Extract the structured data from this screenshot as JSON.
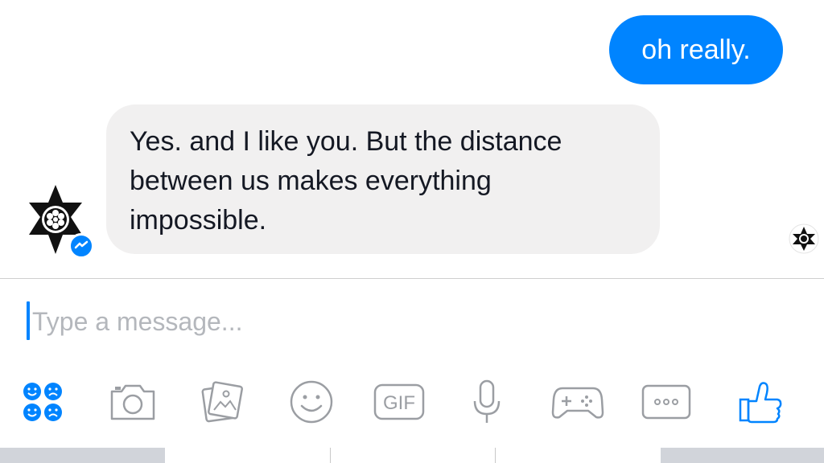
{
  "conversation": {
    "outgoing_message": "oh really.",
    "incoming_message_lines": [
      "Yes. and I like you. But the distance",
      "between us makes everything",
      "impossible."
    ]
  },
  "composer": {
    "placeholder": "Type a message..."
  },
  "toolbar": {
    "icons": [
      "stickers-icon",
      "camera-icon",
      "photos-icon",
      "emoji-icon",
      "gif-icon",
      "microphone-icon",
      "game-controller-icon",
      "more-icon",
      "thumbs-up-icon"
    ],
    "gif_label": "GIF"
  },
  "colors": {
    "accent": "#0084ff",
    "incoming_bubble": "#f1f0f0",
    "icon_gray": "#9b9ea3",
    "placeholder": "#b4b7bc"
  }
}
